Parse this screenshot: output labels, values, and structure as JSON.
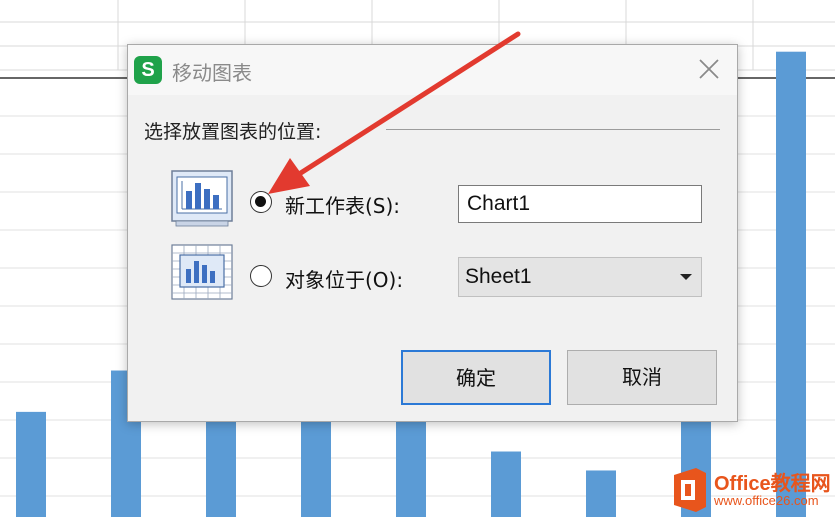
{
  "dialog": {
    "title": "移动图表",
    "app_icon_letter": "S",
    "section_label": "选择放置图表的位置:",
    "option_new_sheet_label": "新工作表(S):",
    "option_new_sheet_value": "Chart1",
    "option_object_label": "对象位于(O):",
    "option_object_value": "Sheet1",
    "selected_option": "new-sheet",
    "ok_label": "确定",
    "cancel_label": "取消",
    "icons": [
      "close-icon",
      "chart-sheet-icon",
      "chart-object-icon",
      "dropdown-arrow-icon"
    ]
  },
  "chart_data": {
    "type": "bar",
    "values": [
      61,
      85,
      96,
      97,
      96,
      38,
      27,
      96,
      270
    ],
    "ylim": [
      0,
      300
    ],
    "bar_color": "#5b9bd5"
  },
  "watermark": {
    "title": "Office教程网",
    "url": "www.office26.com",
    "color": "#e8551c"
  },
  "annotation": {
    "arrow_color": "#e23a2f"
  }
}
